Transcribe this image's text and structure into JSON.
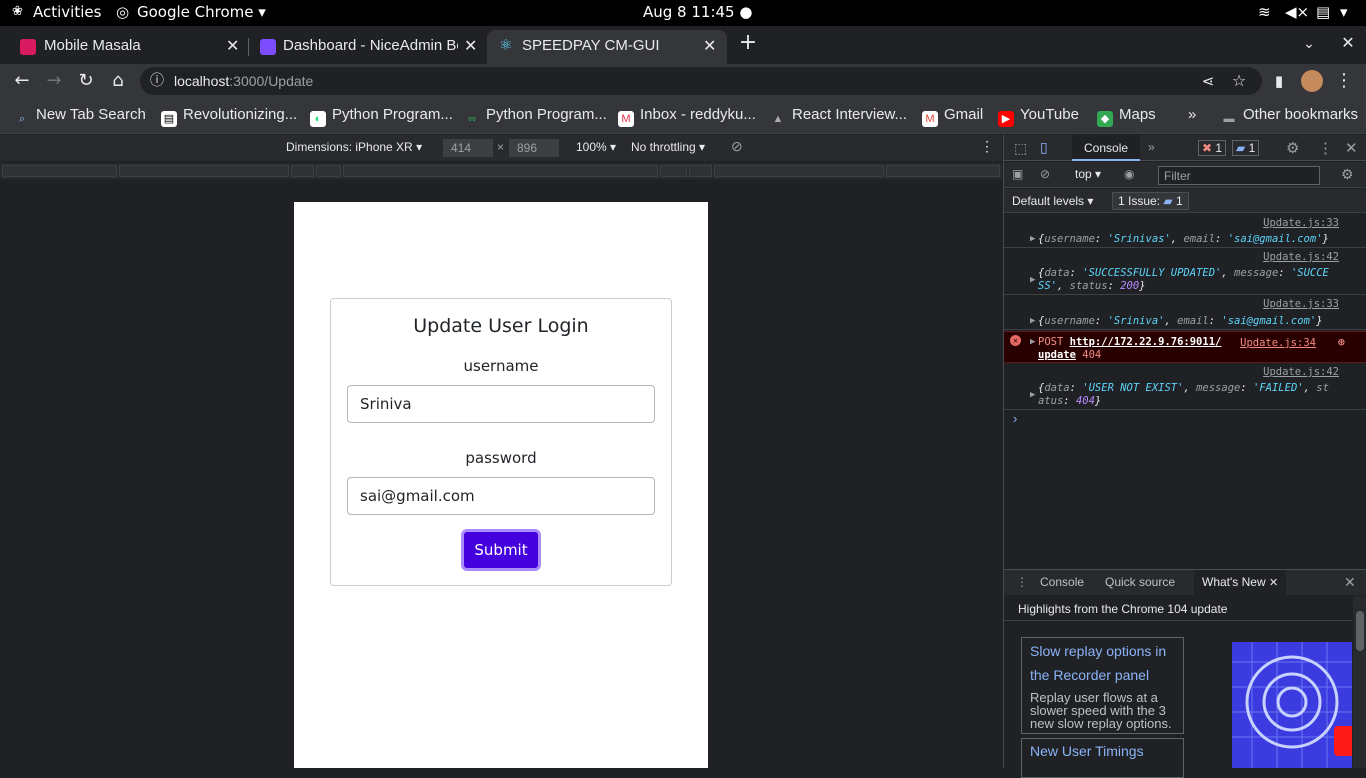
{
  "system_bar": {
    "activities": "Activities",
    "app": "Google Chrome",
    "clock": "Aug 8  11:45"
  },
  "tabs": [
    {
      "title": "Mobile Masala",
      "favicon_color": "#d81b60"
    },
    {
      "title": "Dashboard - NiceAdmin Bo",
      "favicon_color": "#7c4dff"
    },
    {
      "title": "SPEEDPAY CM-GUI",
      "favicon_color": "#61dafb"
    }
  ],
  "omnibox": {
    "host": "localhost",
    "path": ":3000/Update"
  },
  "bookmarks": [
    {
      "label": "New Tab Search"
    },
    {
      "label": "Revolutionizing..."
    },
    {
      "label": "Python Program..."
    },
    {
      "label": "Python Program..."
    },
    {
      "label": "Inbox - reddyku..."
    },
    {
      "label": "React Interview..."
    },
    {
      "label": "Gmail"
    },
    {
      "label": "YouTube"
    },
    {
      "label": "Maps"
    }
  ],
  "other_bookmarks": "Other bookmarks",
  "device": {
    "dimensions": "Dimensions: iPhone XR",
    "width": "414",
    "height": "896",
    "zoom": "100%",
    "throttling": "No throttling",
    "times": "×"
  },
  "app": {
    "title": "Update User Login",
    "username_label": "username",
    "username_value": "Sriniva",
    "password_label": "password",
    "password_value": "sai@gmail.com",
    "submit": "Submit"
  },
  "devtools": {
    "tab_console": "Console",
    "error_count": "1",
    "issue_count": "1",
    "context": "top",
    "filter_placeholder": "Filter",
    "levels": "Default levels",
    "issues_label": "1 Issue:",
    "issues_num": "1",
    "messages": [
      {
        "src": "Update.js:33",
        "line1_html": "{<span class=k>username</span>: <span class=s>'Srinivas'</span>, <span class=k>email</span>: <span class=s>'sai@gmail.com'</span>}"
      },
      {
        "src": "Update.js:42",
        "line1_html": "{<span class=k>data</span>: <span class=s>'SUCCESSFULLY UPDATED'</span>, <span class=k>message</span>: <span class=s>'SUCCE</span>",
        "line2_html": "<span class=s>SS'</span>, <span class=k>status</span>: <span class=n>200</span>}"
      },
      {
        "src": "Update.js:33",
        "line1_html": "{<span class=k>username</span>: <span class=s>'Sriniva'</span>, <span class=k>email</span>: <span class=s>'sai@gmail.com'</span>}"
      },
      {
        "src": "Update.js:34",
        "method": "POST",
        "url": "http://172.22.9.76:9011/",
        "url2": "update",
        "code": "404"
      },
      {
        "src": "Update.js:42",
        "line1_html": "{<span class=k>data</span>: <span class=s>'USER NOT EXIST'</span>, <span class=k>message</span>: <span class=s>'FAILED'</span>, <span class=k>st</span>",
        "line2_html": "<span class=k>atus</span>: <span class=n>404</span>}"
      }
    ],
    "drawer_tabs": [
      "Console",
      "Quick source",
      "What's New"
    ],
    "whats_new_header": "Highlights from the Chrome 104 update",
    "features": [
      {
        "title": "Slow replay options in the Recorder panel",
        "desc": "Replay user flows at a slower speed with the 3 new slow replay options."
      },
      {
        "title": "New User Timings"
      }
    ]
  }
}
